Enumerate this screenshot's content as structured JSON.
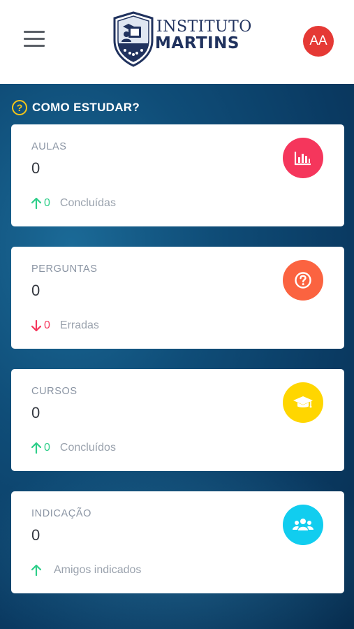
{
  "header": {
    "logo_line1": "INSTITUTO",
    "logo_line2": "MARTINS",
    "avatar_initials": "AA"
  },
  "section": {
    "title": "COMO ESTUDAR?",
    "help_glyph": "?"
  },
  "cards": [
    {
      "label": "AULAS",
      "value": "0",
      "trend": "up",
      "trend_value": "0",
      "trend_text": "Concluídas",
      "icon": "chart-bar-icon",
      "color": "#f5365c"
    },
    {
      "label": "PERGUNTAS",
      "value": "0",
      "trend": "down",
      "trend_value": "0",
      "trend_text": "Erradas",
      "icon": "question-circle-icon",
      "color": "#fb6340"
    },
    {
      "label": "CURSOS",
      "value": "0",
      "trend": "up",
      "trend_value": "0",
      "trend_text": "Concluídos",
      "icon": "graduation-cap-icon",
      "color": "#ffd600"
    },
    {
      "label": "INDICAÇÃO",
      "value": "0",
      "trend": "up",
      "trend_value": "",
      "trend_text": "Amigos indicados",
      "icon": "users-icon",
      "color": "#11cdef"
    }
  ],
  "colors": {
    "accent_yellow": "#f5c518",
    "up_green": "#2dce89",
    "down_red": "#f5365c",
    "avatar_red": "#e53935",
    "brand_navy": "#20325e"
  }
}
